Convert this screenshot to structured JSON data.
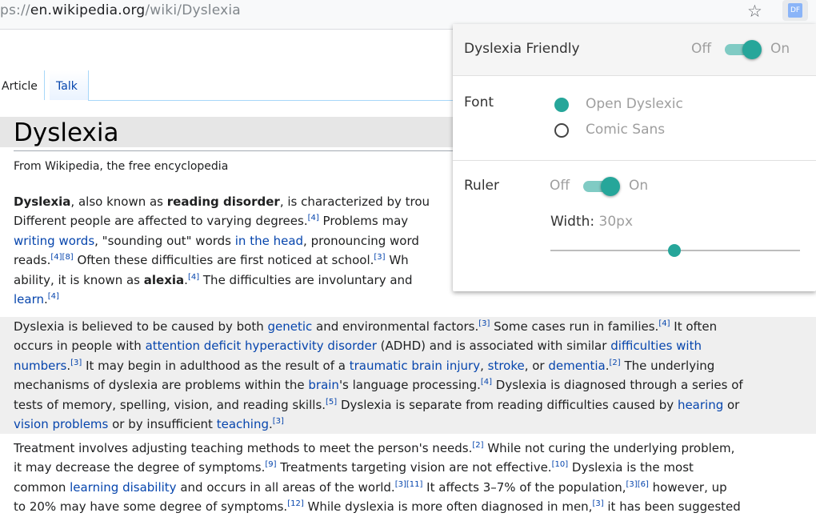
{
  "browser": {
    "url_prefix": "ps://",
    "url_host": "en.wikipedia.org",
    "url_path": "/wiki/Dyslexia",
    "extension_icon_label": "DF"
  },
  "tabs": {
    "article": "Article",
    "talk": "Talk"
  },
  "article": {
    "title": "Dyslexia",
    "tagline": "From Wikipedia, the free encyclopedia",
    "p1": {
      "l1_b1": "Dyslexia",
      "l1_t1": ", also known as ",
      "l1_b2": "reading disorder",
      "l1_t2": ", is characterized by trou",
      "l2_t1": "Different people are affected to varying degrees.",
      "l2_s1": "[4]",
      "l2_t2": " Problems may",
      "l3_a1": "writing words",
      "l3_t1": ", \"sounding out\" words ",
      "l3_a2": "in the head",
      "l3_t2": ", pronouncing word",
      "l4_t1": "reads.",
      "l4_s1": "[4][8]",
      "l4_t2": " Often these difficulties are first noticed at school.",
      "l4_s2": "[3]",
      "l4_t3": " Wh",
      "l5_t1": "ability, it is known as ",
      "l5_b1": "alexia",
      "l5_t2": ".",
      "l5_s1": "[4]",
      "l5_t3": " The difficulties are involuntary and",
      "l6_a1": "learn",
      "l6_t1": ".",
      "l6_s1": "[4]"
    },
    "p2": {
      "l1_t1": "Dyslexia is believed to be caused by both ",
      "l1_a1": "genetic",
      "l1_t2": " and environmental factors.",
      "l1_s1": "[3]",
      "l1_t3": " Some cases run in families.",
      "l1_s2": "[4]",
      "l1_t4": " It often",
      "l2_t1": "occurs in people with ",
      "l2_a1": "attention deficit hyperactivity disorder",
      "l2_t2": " (ADHD) and is associated with similar ",
      "l2_a2": "difficulties with",
      "l3_a1": "numbers",
      "l3_t1": ".",
      "l3_s1": "[3]",
      "l3_t2": " It may begin in adulthood as the result of a ",
      "l3_a2": "traumatic brain injury",
      "l3_t3": ", ",
      "l3_a3": "stroke",
      "l3_t4": ", or ",
      "l3_a4": "dementia",
      "l3_t5": ".",
      "l3_s2": "[2]",
      "l3_t6": " The underlying",
      "l4_t1": "mechanisms of dyslexia are problems within the ",
      "l4_a1": "brain",
      "l4_t2": "'s language processing.",
      "l4_s1": "[4]",
      "l4_t3": " Dyslexia is diagnosed through a series of",
      "l5_t1": "tests of memory, spelling, vision, and reading skills.",
      "l5_s1": "[5]",
      "l5_t2": " Dyslexia is separate from reading difficulties caused by ",
      "l5_a1": "hearing",
      "l5_t3": " or",
      "l6_a1": "vision problems",
      "l6_t1": " or by insufficient ",
      "l6_a2": "teaching",
      "l6_t2": ".",
      "l6_s1": "[3]"
    },
    "p3": {
      "l1_t1": "Treatment involves adjusting teaching methods to meet the person's needs.",
      "l1_s1": "[2]",
      "l1_t2": " While not curing the underlying problem,",
      "l2_t1": "it may decrease the degree of symptoms.",
      "l2_s1": "[9]",
      "l2_t2": " Treatments targeting vision are not effective.",
      "l2_s2": "[10]",
      "l2_t3": " Dyslexia is the most",
      "l3_t1": "common ",
      "l3_a1": "learning disability",
      "l3_t2": " and occurs in all areas of the world.",
      "l3_s1": "[3][11]",
      "l3_t3": " It affects 3–7% of the population,",
      "l3_s2": "[3][6]",
      "l3_t4": " however, up",
      "l4_t1": "to 20% may have some degree of symptoms.",
      "l4_s1": "[12]",
      "l4_t2": " While dyslexia is more often diagnosed in men,",
      "l4_s2": "[3]",
      "l4_t3": " it has been suggested"
    }
  },
  "popup": {
    "title": "Dyslexia Friendly",
    "toggle_off": "Off",
    "toggle_on": "On",
    "enabled": true,
    "font_label": "Font",
    "font_options": [
      "Open Dyslexic",
      "Comic Sans"
    ],
    "font_selected": "Open Dyslexic",
    "ruler_label": "Ruler",
    "ruler_off": "Off",
    "ruler_on": "On",
    "ruler_enabled": true,
    "width_label": "Width:",
    "width_value": "30px",
    "slider_fraction": 0.5,
    "accent_color": "#26a69a"
  }
}
